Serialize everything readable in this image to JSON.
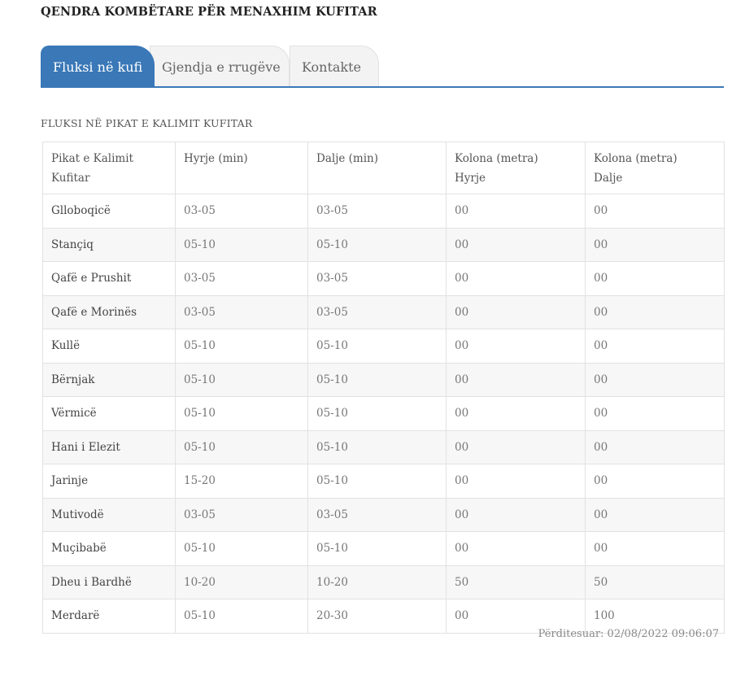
{
  "page": {
    "title": "QENDRA KOMBËTARE PËR MENAXHIM KUFITAR"
  },
  "tabs": [
    {
      "label": "Fluksi në kufi",
      "active": true
    },
    {
      "label": "Gjendja e rrugëve",
      "active": false
    },
    {
      "label": "Kontakte",
      "active": false
    }
  ],
  "section": {
    "title": "FLUKSI NË PIKAT E KALIMIT KUFITAR"
  },
  "table": {
    "headers": [
      {
        "line1": "Pikat e Kalimit",
        "line2": "Kufitar"
      },
      {
        "line1": "Hyrje (min)",
        "line2": ""
      },
      {
        "line1": "Dalje (min)",
        "line2": ""
      },
      {
        "line1": "Kolona (metra)",
        "line2": "Hyrje"
      },
      {
        "line1": "Kolona (metra)",
        "line2": "Dalje"
      }
    ],
    "rows": [
      [
        "Glloboqicë",
        "03-05",
        "03-05",
        "00",
        "00"
      ],
      [
        "Stançiq",
        "05-10",
        "05-10",
        "00",
        "00"
      ],
      [
        "Qafë e Prushit",
        "03-05",
        "03-05",
        "00",
        "00"
      ],
      [
        "Qafë e Morinës",
        "03-05",
        "03-05",
        "00",
        "00"
      ],
      [
        "Kullë",
        "05-10",
        "05-10",
        "00",
        "00"
      ],
      [
        "Bërnjak",
        "05-10",
        "05-10",
        "00",
        "00"
      ],
      [
        "Vërmicë",
        "05-10",
        "05-10",
        "00",
        "00"
      ],
      [
        "Hani i Elezit",
        "05-10",
        "05-10",
        "00",
        "00"
      ],
      [
        "Jarinje",
        "15-20",
        "05-10",
        "00",
        "00"
      ],
      [
        "Mutivodë",
        "03-05",
        "03-05",
        "00",
        "00"
      ],
      [
        "Muçibabë",
        "05-10",
        "05-10",
        "00",
        "00"
      ],
      [
        "Dheu i Bardhë",
        "10-20",
        "10-20",
        "50",
        "50"
      ],
      [
        "Merdarë",
        "05-10",
        "20-30",
        "00",
        "100"
      ]
    ]
  },
  "footer": {
    "updated": "Përditesuar: 02/08/2022 09:06:07"
  },
  "colors": {
    "accent": "#3a78b7",
    "tab_inactive": "#f3f3f3",
    "row_alt": "#f7f7f7",
    "border": "#e2e2e2"
  }
}
